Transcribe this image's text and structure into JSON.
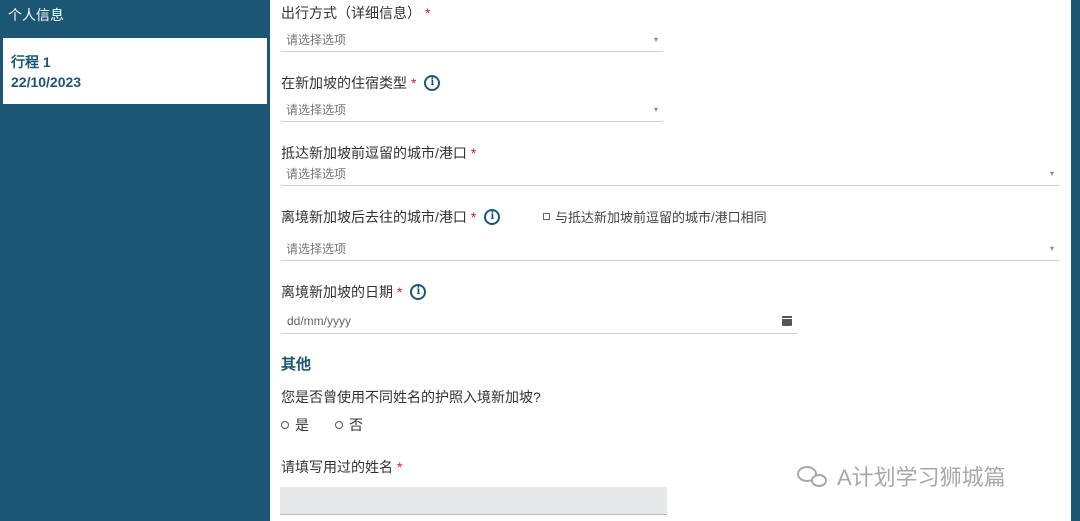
{
  "sidebar": {
    "header": "个人信息",
    "trip": {
      "title": "行程 1",
      "date": "22/10/2023"
    }
  },
  "form": {
    "travel_mode": {
      "label": "出行方式（详细信息）",
      "required": "*",
      "placeholder": "请选择选项"
    },
    "accommodation": {
      "label": "在新加坡的住宿类型",
      "required": "*",
      "info_icon": "i",
      "placeholder": "请选择选项"
    },
    "last_city_before": {
      "label": "抵达新加坡前逗留的城市/港口",
      "required": "*",
      "placeholder": "请选择选项"
    },
    "next_city_after": {
      "label": "离境新加坡后去往的城市/港口",
      "required": "*",
      "info_icon": "i",
      "placeholder": "请选择选项",
      "same_checkbox_label": "与抵达新加坡前逗留的城市/港口相同"
    },
    "departure_date": {
      "label": "离境新加坡的日期",
      "required": "*",
      "info_icon": "i",
      "placeholder": "dd/mm/yyyy"
    },
    "other": {
      "title": "其他",
      "question": "您是否曾使用不同姓名的护照入境新加坡?",
      "options": [
        "是",
        "否"
      ],
      "name_label": "请填写用过的姓名",
      "required": "*"
    }
  },
  "watermark": {
    "text": "A计划学习狮城篇",
    "icon": "wechat-icon"
  },
  "colors": {
    "primary": "#1b5775",
    "required": "#c8202c"
  }
}
